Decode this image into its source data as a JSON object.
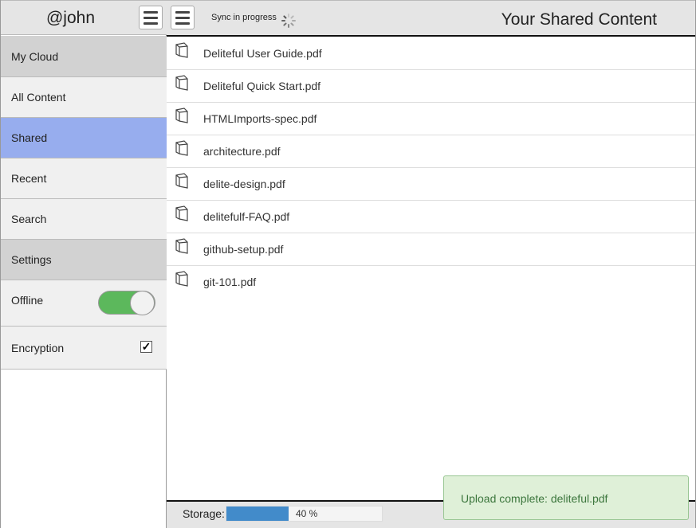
{
  "sidebar": {
    "user": "@john",
    "menu_icon": "hamburger-icon",
    "items": [
      {
        "label": "My Cloud"
      },
      {
        "label": "All Content"
      },
      {
        "label": "Shared"
      },
      {
        "label": "Recent"
      },
      {
        "label": "Search"
      },
      {
        "label": "Settings"
      },
      {
        "label": "Offline",
        "toggle": true
      },
      {
        "label": "Encryption",
        "checked": true
      }
    ]
  },
  "header": {
    "menu_icon": "hamburger-icon",
    "sync_text": "Sync in progress",
    "spinner_icon": "spinner-icon",
    "title": "Your Shared Content"
  },
  "files": [
    {
      "name": "Deliteful User Guide.pdf",
      "icon": "document-icon"
    },
    {
      "name": "Deliteful Quick Start.pdf",
      "icon": "document-icon"
    },
    {
      "name": "HTMLImports-spec.pdf",
      "icon": "document-icon"
    },
    {
      "name": "architecture.pdf",
      "icon": "document-icon"
    },
    {
      "name": "delite-design.pdf",
      "icon": "document-icon"
    },
    {
      "name": "delitefulf-FAQ.pdf",
      "icon": "document-icon"
    },
    {
      "name": "github-setup.pdf",
      "icon": "document-icon"
    },
    {
      "name": "git-101.pdf",
      "icon": "document-icon"
    }
  ],
  "footer": {
    "storage_label": "Storage:",
    "progress_value": 40,
    "progress_text": "40 %"
  },
  "toast": {
    "message": "Upload complete: deliteful.pdf"
  },
  "colors": {
    "active_item": "#97adee",
    "toggle_on": "#5cb85c",
    "progress": "#428bca",
    "toast_bg": "#dff0d8",
    "toast_text": "#3c763d"
  }
}
